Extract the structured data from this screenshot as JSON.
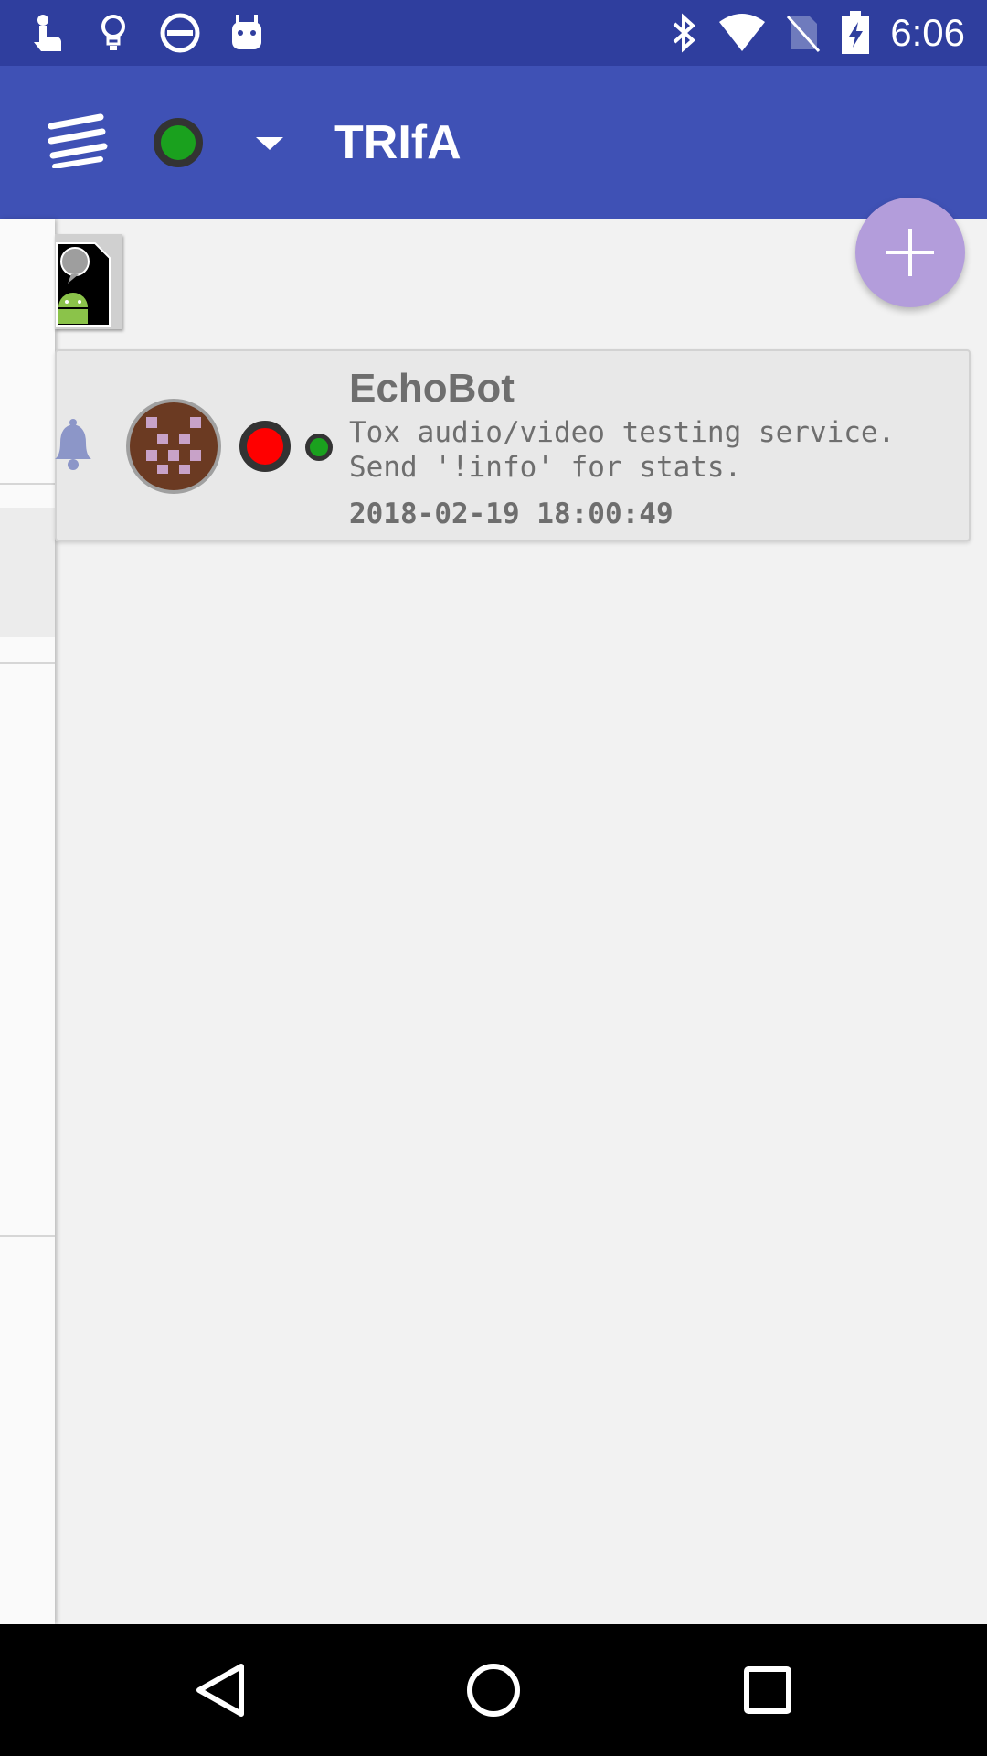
{
  "status_bar": {
    "time": "6:06",
    "left_icons": [
      "touch-icon",
      "lightbulb-icon",
      "do-not-disturb-icon",
      "android-icon"
    ],
    "right_icons": [
      "bluetooth-icon",
      "wifi-icon",
      "no-sim-icon",
      "battery-charging-icon"
    ],
    "background": "#2f3e9e"
  },
  "app_bar": {
    "title": "TRIfA",
    "background": "#3f51b5",
    "status_color": "#1aa11e"
  },
  "fab": {
    "color": "#b39ddb",
    "icon": "plus-icon"
  },
  "friends": [
    {
      "name": "EchoBot",
      "status_message": "Tox audio/video testing service.\nSend '!info' for stats.",
      "last_online": "2018-02-19 18:00:49",
      "connection_color": "#ff0000",
      "online_color": "#1aa11e"
    }
  ],
  "nav_bar": {
    "icons": [
      "back-icon",
      "home-icon",
      "recents-icon"
    ]
  }
}
